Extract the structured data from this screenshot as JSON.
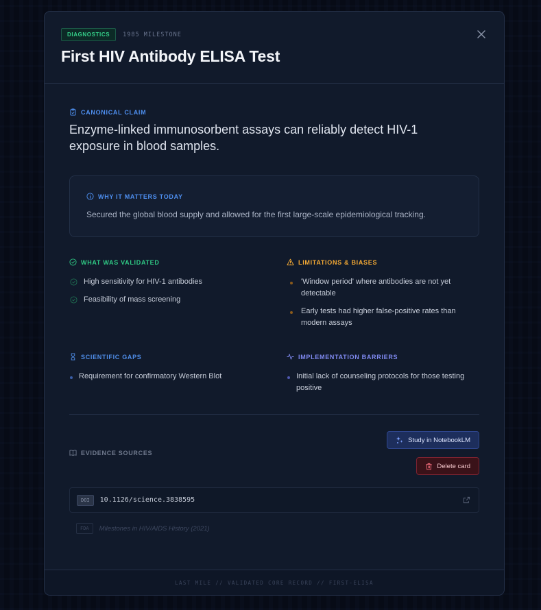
{
  "modal": {
    "tag": "DIAGNOSTICS",
    "milestone": "1985 MILESTONE",
    "title": "First HIV Antibody ELISA Test",
    "close_icon": "close-icon"
  },
  "claim": {
    "label": "CANONICAL CLAIM",
    "icon": "clipboard-check-icon",
    "text": "Enzyme-linked immunosorbent assays can reliably detect HIV-1 exposure in blood samples."
  },
  "matters": {
    "label": "WHY IT MATTERS TODAY",
    "icon": "info-circle-icon",
    "text": "Secured the global blood supply and allowed for the first large-scale epidemiological tracking."
  },
  "validated": {
    "label": "WHAT WAS VALIDATED",
    "icon": "check-circle-icon",
    "color": "#2fc884",
    "items": [
      "High sensitivity for HIV-1 antibodies",
      "Feasibility of mass screening"
    ]
  },
  "limitations": {
    "label": "LIMITATIONS & BIASES",
    "icon": "warning-triangle-icon",
    "color": "#f2a834",
    "items": [
      "'Window period' where antibodies are not yet detectable",
      "Early tests had higher false-positive rates than modern assays"
    ]
  },
  "gaps": {
    "label": "SCIENTIFIC GAPS",
    "icon": "hourglass-icon",
    "color": "#4f8de8",
    "items": [
      "Requirement for confirmatory Western Blot"
    ]
  },
  "barriers": {
    "label": "IMPLEMENTATION BARRIERS",
    "icon": "activity-pulse-icon",
    "color": "#7f89f0",
    "items": [
      "Initial lack of counseling protocols for those testing positive"
    ]
  },
  "evidence": {
    "label": "EVIDENCE SOURCES",
    "icon": "book-open-icon",
    "notebook_button": "Study in NotebookLM",
    "delete_button": "Delete card",
    "sources": [
      {
        "type": "DOI",
        "value": "10.1126/science.3838595"
      },
      {
        "type": "FDA",
        "value": "Milestones in HIV/AIDS History (2021)"
      }
    ]
  },
  "footer": "LAST MILE // VALIDATED CORE RECORD // FIRST-ELISA"
}
